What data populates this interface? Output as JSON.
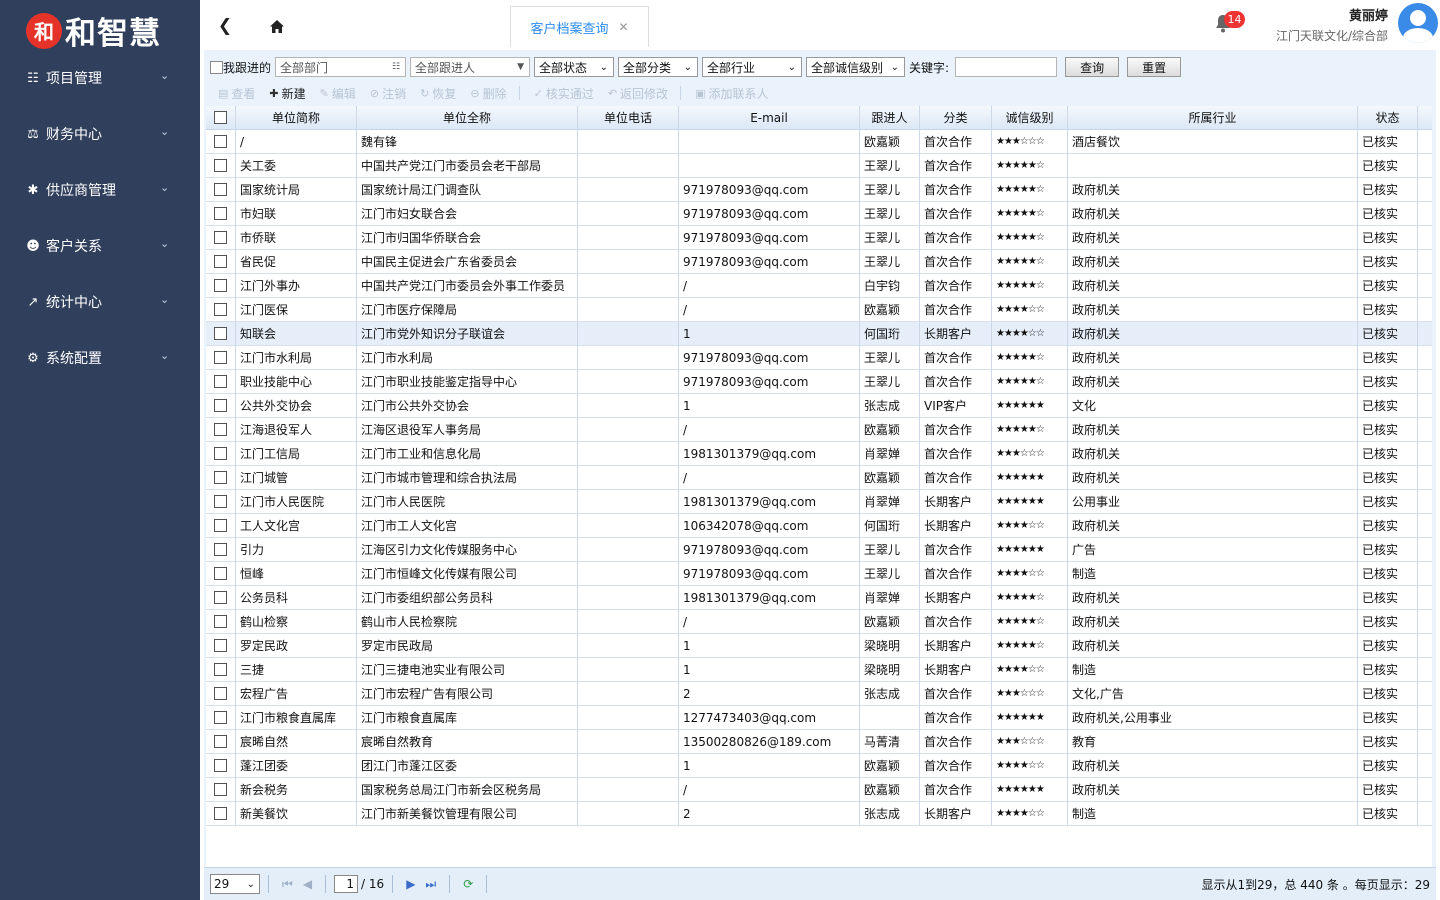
{
  "brand": {
    "badge": "和",
    "name": "和智慧"
  },
  "sidebar": {
    "items": [
      {
        "label": "项目管理",
        "icon": "project-icon"
      },
      {
        "label": "财务中心",
        "icon": "finance-icon"
      },
      {
        "label": "供应商管理",
        "icon": "supplier-icon"
      },
      {
        "label": "客户关系",
        "icon": "customers-icon"
      },
      {
        "label": "统计中心",
        "icon": "stats-icon"
      },
      {
        "label": "系统配置",
        "icon": "settings-icon"
      }
    ]
  },
  "topbar": {
    "tab_label": "客户档案查询",
    "notification_count": "14",
    "user_name": "黄丽婷",
    "user_org": "江门天联文化/综合部"
  },
  "filters": {
    "mine_label": "我跟进的",
    "department": "全部部门",
    "follower": "全部跟进人",
    "status": "全部状态",
    "category": "全部分类",
    "industry": "全部行业",
    "credit": "全部诚信级别",
    "keyword_label": "关键字:",
    "keyword_value": "",
    "query_button": "查询",
    "reset_button": "重置"
  },
  "toolbar": {
    "view": "查看",
    "new": "新建",
    "edit": "编辑",
    "cancel": "注销",
    "restore": "恢复",
    "delete": "删除",
    "verify": "核实通过",
    "return": "返回修改",
    "add_contact": "添加联系人"
  },
  "table": {
    "columns": [
      "单位简称",
      "单位全称",
      "单位电话",
      "E-mail",
      "跟进人",
      "分类",
      "诚信级别",
      "所属行业",
      "状态"
    ],
    "rows": [
      [
        "/",
        "魏有锋",
        "",
        "",
        "欧嘉颖",
        "首次合作",
        "★★★☆☆☆",
        "酒店餐饮",
        "已核实"
      ],
      [
        "关工委",
        "中国共产党江门市委员会老干部局",
        "",
        "",
        "王翠儿",
        "首次合作",
        "★★★★★☆",
        "",
        "已核实"
      ],
      [
        "国家统计局",
        "国家统计局江门调查队",
        "",
        "971978093@qq.com",
        "王翠儿",
        "首次合作",
        "★★★★★☆",
        "政府机关",
        "已核实"
      ],
      [
        "市妇联",
        "江门市妇女联合会",
        "",
        "971978093@qq.com",
        "王翠儿",
        "首次合作",
        "★★★★★☆",
        "政府机关",
        "已核实"
      ],
      [
        "市侨联",
        "江门市归国华侨联合会",
        "",
        "971978093@qq.com",
        "王翠儿",
        "首次合作",
        "★★★★★☆",
        "政府机关",
        "已核实"
      ],
      [
        "省民促",
        "中国民主促进会广东省委员会",
        "",
        "971978093@qq.com",
        "王翠儿",
        "首次合作",
        "★★★★★☆",
        "政府机关",
        "已核实"
      ],
      [
        "江门外事办",
        "中国共产党江门市委员会外事工作委员",
        "",
        "/",
        "白宇钧",
        "首次合作",
        "★★★★★☆",
        "政府机关",
        "已核实"
      ],
      [
        "江门医保",
        "江门市医疗保障局",
        "",
        "/",
        "欧嘉颖",
        "首次合作",
        "★★★★☆☆",
        "政府机关",
        "已核实"
      ],
      [
        "知联会",
        "江门市党外知识分子联谊会",
        "",
        "1",
        "何国珩",
        "长期客户",
        "★★★★☆☆",
        "政府机关",
        "已核实"
      ],
      [
        "江门市水利局",
        "江门市水利局",
        "",
        "971978093@qq.com",
        "王翠儿",
        "首次合作",
        "★★★★★☆",
        "政府机关",
        "已核实"
      ],
      [
        "职业技能中心",
        "江门市职业技能鉴定指导中心",
        "",
        "971978093@qq.com",
        "王翠儿",
        "首次合作",
        "★★★★★☆",
        "政府机关",
        "已核实"
      ],
      [
        "公共外交协会",
        "江门市公共外交协会",
        "",
        "1",
        "张志成",
        "VIP客户",
        "★★★★★★",
        "文化",
        "已核实"
      ],
      [
        "江海退役军人",
        "江海区退役军人事务局",
        "",
        "/",
        "欧嘉颖",
        "首次合作",
        "★★★★★☆",
        "政府机关",
        "已核实"
      ],
      [
        "江门工信局",
        "江门市工业和信息化局",
        "",
        "1981301379@qq.com",
        "肖翠婵",
        "首次合作",
        "★★★☆☆☆",
        "政府机关",
        "已核实"
      ],
      [
        "江门城管",
        "江门市城市管理和综合执法局",
        "",
        "/",
        "欧嘉颖",
        "首次合作",
        "★★★★★★",
        "政府机关",
        "已核实"
      ],
      [
        "江门市人民医院",
        "江门市人民医院",
        "",
        "1981301379@qq.com",
        "肖翠婵",
        "长期客户",
        "★★★★★★",
        "公用事业",
        "已核实"
      ],
      [
        "工人文化宫",
        "江门市工人文化宫",
        "",
        "106342078@qq.com",
        "何国珩",
        "长期客户",
        "★★★★☆☆",
        "政府机关",
        "已核实"
      ],
      [
        "引力",
        "江海区引力文化传媒服务中心",
        "",
        "971978093@qq.com",
        "王翠儿",
        "首次合作",
        "★★★★★★",
        "广告",
        "已核实"
      ],
      [
        "恒峰",
        "江门市恒峰文化传媒有限公司",
        "",
        "971978093@qq.com",
        "王翠儿",
        "首次合作",
        "★★★★☆☆",
        "制造",
        "已核实"
      ],
      [
        "公务员科",
        "江门市委组织部公务员科",
        "",
        "1981301379@qq.com",
        "肖翠婵",
        "长期客户",
        "★★★★★☆",
        "政府机关",
        "已核实"
      ],
      [
        "鹤山检察",
        "鹤山市人民检察院",
        "",
        "/",
        "欧嘉颖",
        "首次合作",
        "★★★★★☆",
        "政府机关",
        "已核实"
      ],
      [
        "罗定民政",
        "罗定市民政局",
        "",
        "1",
        "梁晓明",
        "长期客户",
        "★★★★★☆",
        "政府机关",
        "已核实"
      ],
      [
        "三捷",
        "江门三捷电池实业有限公司",
        "",
        "1",
        "梁晓明",
        "长期客户",
        "★★★★☆☆",
        "制造",
        "已核实"
      ],
      [
        "宏程广告",
        "江门市宏程广告有限公司",
        "",
        "2",
        "张志成",
        "首次合作",
        "★★★☆☆☆",
        "文化,广告",
        "已核实"
      ],
      [
        "江门市粮食直属库",
        "江门市粮食直属库",
        "",
        "1277473403@qq.com",
        "",
        "首次合作",
        "★★★★★★",
        "政府机关,公用事业",
        "已核实"
      ],
      [
        "宸晞自然",
        "宸晞自然教育",
        "",
        "13500280826@189.com",
        "马菁清",
        "首次合作",
        "★★★☆☆☆",
        "教育",
        "已核实"
      ],
      [
        "蓬江团委",
        "团江门市蓬江区委",
        "",
        "1",
        "欧嘉颖",
        "首次合作",
        "★★★★☆☆",
        "政府机关",
        "已核实"
      ],
      [
        "新会税务",
        "国家税务总局江门市新会区税务局",
        "",
        "/",
        "欧嘉颖",
        "首次合作",
        "★★★★★★",
        "政府机关",
        "已核实"
      ],
      [
        "新美餐饮",
        "江门市新美餐饮管理有限公司",
        "",
        "2",
        "张志成",
        "长期客户",
        "★★★★☆☆",
        "制造",
        "已核实"
      ]
    ]
  },
  "pager": {
    "page_size": "29",
    "current_page": "1",
    "total_pages": "/ 16",
    "info": "显示从1到29，总 440 条 。每页显示：29"
  }
}
